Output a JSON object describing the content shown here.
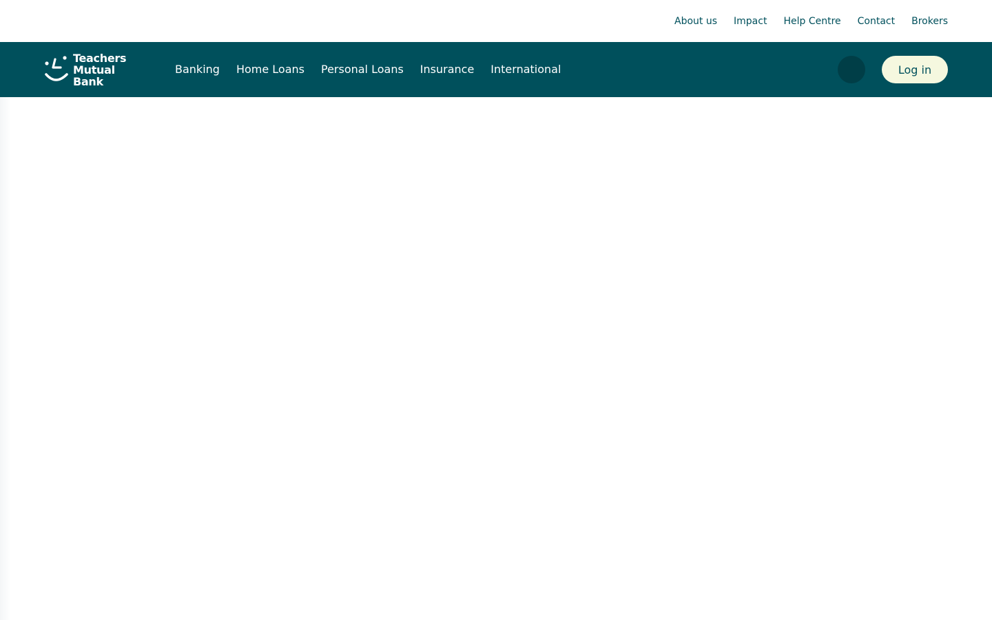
{
  "utility_nav": {
    "links": [
      {
        "label": "About us"
      },
      {
        "label": "Impact"
      },
      {
        "label": "Help Centre"
      },
      {
        "label": "Contact"
      },
      {
        "label": "Brokers"
      }
    ]
  },
  "main_nav": {
    "logo": {
      "line1": "Teachers",
      "line2": "Mutual Bank"
    },
    "links": [
      {
        "label": "Banking"
      },
      {
        "label": "Home Loans"
      },
      {
        "label": "Personal Loans"
      },
      {
        "label": "Insurance"
      },
      {
        "label": "International"
      }
    ],
    "search_icon": "search-icon",
    "login_label": "Log in"
  },
  "colors": {
    "brand_teal": "#00505c",
    "login_bg": "#f5f8df",
    "search_bg": "#003e47"
  }
}
